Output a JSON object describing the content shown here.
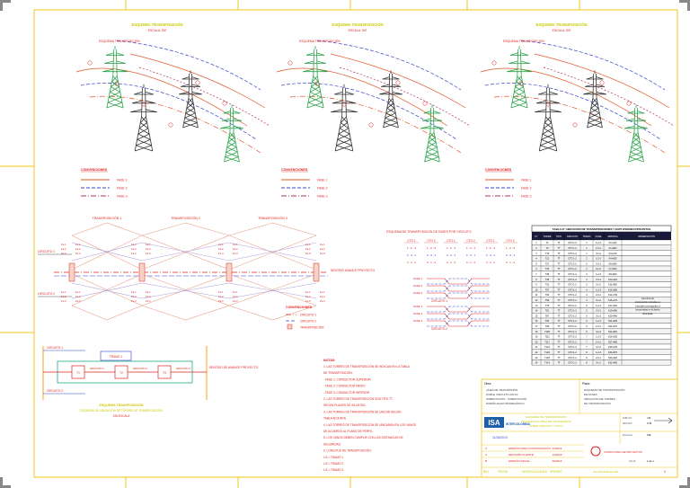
{
  "panels": [
    {
      "title": "ESQUEMA TRANSPOSICIÓN",
      "sub": "ESCALA: S/E",
      "legend": "CONVENCIONES",
      "phases": [
        "FASE 1",
        "FASE 2",
        "FASE 3"
      ]
    },
    {
      "title": "ESQUEMA TRANSPOSICIÓN",
      "sub": "ESCALA: S/E",
      "legend": "CONVENCIONES",
      "phases": [
        "FASE 1",
        "FASE 2",
        "FASE 3"
      ]
    },
    {
      "title": "ESQUEMA TRANSPOSICIÓN",
      "sub": "ESCALA: S/E",
      "legend": "CONVENCIONES",
      "phases": [
        "FASE 1",
        "FASE 2",
        "FASE 3"
      ]
    }
  ],
  "circuit_diagram": {
    "transp_labels": [
      "TRANSPOSICIÓN 1",
      "TRANSPOSICIÓN 2",
      "TRANSPOSICIÓN 3"
    ],
    "left_labels": [
      "CIRCUITO 1",
      "CIRCUITO 2"
    ],
    "right_label": "SENTIDO AVANCE PROYECTO",
    "legend_title": "CONVENCIONES",
    "legend_items": [
      "CIRCUITO 1",
      "CIRCUITO 2",
      "TRANSPOSICIÓN"
    ],
    "phase_letters": [
      "Fa 1",
      "Fa 2",
      "Fa 3"
    ]
  },
  "phase_table": {
    "title": "ESQUEMA DE TRANSPOSICIÓN DE FASES POR CIRCUITO",
    "headers": [
      "CTO 1",
      "CTO 2",
      "CTO 1",
      "CTO 2",
      "CTO 1",
      "CTO 2"
    ],
    "rows": [
      "1 - 2 - 3",
      "2 - 3 - 1",
      "3 - 1 - 2"
    ],
    "section_a": "CIRCUITO 1",
    "section_b": "CIRCUITO 2",
    "fase_labels": [
      "FASE 1",
      "FASE 2",
      "FASE 3"
    ]
  },
  "block_diagram": {
    "circuito_top": "CIRCUITO 1",
    "circuito_bottom": "CIRCUITO 2",
    "top_box": "TRAMO 1",
    "boxes": [
      "T1",
      "T2",
      "T3"
    ],
    "section_labels": [
      "SECCIÓN 1",
      "SECCIÓN 2",
      "SECCIÓN 3"
    ],
    "right_title": "SENTIDO DE AVANCE PROYECTO",
    "caption_title": "ESQUEMA TRANSPOSICIÓN",
    "caption_sub": "ESQUEMA DE UBICACIÓN DE TORRES DE TRANSPOSICIÓN",
    "caption_scale": "SIN ESCALA"
  },
  "notes": {
    "title": "NOTAS:",
    "lines": [
      "1. LAS TORRES DE TRANSPOSICIÓN SE INDICAN EN LA TABLA",
      "   DE TRANSPOSICIÓN.",
      "   - FASE 1: CONDUCTOR SUPERIOR",
      "   - FASE 2: CONDUCTOR MEDIO",
      "   - FASE 3: CONDUCTOR INFERIOR",
      "2. LAS TORRES DE TRANSPOSICIÓN SON TIPO TT.",
      "   SEGÚN PLANOS DE SILUETAS.",
      "3. LAS TORRES DE TRANSPOSICIÓN SE UBICAN SEGÚN",
      "   TABLA ADJUNTA.",
      "4. LAS TORRES DE TRANSPOSICIÓN SE UBICARÁN EN LOS VANOS",
      "   DE ACUERDO AL PLANO DE PERFIL.",
      "5. LOS VANOS DEBEN CUMPLIR CON LAS DISTANCIAS DE",
      "   SEGURIDAD.",
      "6. LONGITUD DE TRANSPOSICIÓN:",
      "      L/3 = TRAMO 1",
      "      L/3 = TRAMO 2",
      "      L/3 = TRAMO 3"
    ]
  },
  "table": {
    "title": "TABLA N° UBICACIÓN DE TRANSPOSICIONES Y EXPLOSIONES PREVISTAS",
    "headers": [
      "N°",
      "TORRE",
      "TIPO",
      "CIRCUITO",
      "TRAMO",
      "FASE",
      "ABSCISA",
      "OBSERVACIÓN"
    ],
    "rows": [
      [
        "1",
        "T4",
        "TT",
        "CTO 1-2",
        "1",
        "1-2-3",
        "K0+420",
        ""
      ],
      [
        "2",
        "T9",
        "TT",
        "CTO 1-2",
        "1",
        "2-3-1",
        "K1+860",
        ""
      ],
      [
        "3",
        "T15",
        "TT",
        "CTO 1-2",
        "1",
        "3-1-2",
        "K3+210",
        ""
      ],
      [
        "4",
        "T21",
        "TT",
        "CTO 1-2",
        "2",
        "1-2-3",
        "K4+650",
        ""
      ],
      [
        "5",
        "T27",
        "TT",
        "CTO 1-2",
        "2",
        "2-3-1",
        "K6+080",
        ""
      ],
      [
        "6",
        "T33",
        "TT",
        "CTO 1-2",
        "2",
        "3-1-2",
        "K7+520",
        ""
      ],
      [
        "7",
        "T39",
        "TT",
        "CTO 1-2",
        "3",
        "1-2-3",
        "K8+960",
        ""
      ],
      [
        "8",
        "T45",
        "TT",
        "CTO 1-2",
        "3",
        "2-3-1",
        "K10+410",
        ""
      ],
      [
        "9",
        "T51",
        "TT",
        "CTO 1-2",
        "3",
        "3-1-2",
        "K11+850",
        ""
      ],
      [
        "10",
        "T57",
        "TT",
        "CTO 1-2",
        "4",
        "1-2-3",
        "K13+290",
        ""
      ],
      [
        "11",
        "T63",
        "TT",
        "CTO 1-2",
        "4",
        "2-3-1",
        "K14+730",
        ""
      ],
      [
        "12",
        "T69",
        "TT",
        "CTO 1-2",
        "4",
        "3-1-2",
        "K16+170",
        ""
      ],
      [
        "13",
        "T75",
        "TT",
        "CTO 1-2",
        "5",
        "1-2-3",
        "K17+610",
        ""
      ],
      [
        "14",
        "T81",
        "TT",
        "CTO 1-2",
        "5",
        "2-3-1",
        "K19+050",
        ""
      ],
      [
        "15",
        "T87",
        "TT",
        "CTO 1-2",
        "5",
        "3-1-2",
        "K20+490",
        ""
      ],
      [
        "16",
        "T93",
        "TT",
        "CTO 1-2",
        "6",
        "1-2-3",
        "K21+930",
        ""
      ],
      [
        "17",
        "T99",
        "TT",
        "CTO 1-2",
        "6",
        "2-3-1",
        "K23+370",
        ""
      ],
      [
        "18",
        "T105",
        "TT",
        "CTO 1-2",
        "6",
        "3-1-2",
        "K24+810",
        ""
      ],
      [
        "19",
        "T111",
        "TT",
        "CTO 1-2",
        "7",
        "1-2-3",
        "K26+250",
        ""
      ],
      [
        "20",
        "T117",
        "TT",
        "CTO 1-2",
        "7",
        "2-3-1",
        "K27+690",
        ""
      ],
      [
        "21",
        "T123",
        "TT",
        "CTO 1-2",
        "7",
        "3-1-2",
        "K29+130",
        ""
      ],
      [
        "22",
        "T129",
        "TT",
        "CTO 1-2",
        "8",
        "1-2-3",
        "K30+570",
        ""
      ],
      [
        "23",
        "T135",
        "TT",
        "CTO 1-2",
        "8",
        "2-3-1",
        "K32+010",
        ""
      ],
      [
        "24",
        "T141",
        "TT",
        "CTO 1-2",
        "8",
        "3-1-2",
        "K33+450",
        ""
      ]
    ],
    "side_note": "Las torres de transposición indicadas en esta tabla corresponden a las previstas en el diseño de la línea."
  },
  "titleblock": {
    "left_title": "Obra:",
    "left_lines": [
      "LÍNEA DE TRANSMISIÓN",
      "DOBLE CIRCUITO 230 kV",
      "SUBESTACIÓN - SUBESTACIÓN",
      "DISEÑO ELECTROMECÁNICO"
    ],
    "right_title": "Plano:",
    "right_lines": [
      "ESQUEMA DE TRANSPOSICIÓN",
      "DE FASES",
      "UBICACIÓN DE TORRES",
      "DE TRANSPOSICIÓN"
    ],
    "logo": "ISA",
    "logo_sub": "INTERCOLOMBIA",
    "desc_lines": [
      "ESQUEMA DE TRANSPOSICIÓN",
      "DE FASES EN LÍNEA DE TRANSMISIÓN",
      "DOBLE CIRCUITO - 230 kV"
    ],
    "drawn_label": "DIBUJÓ",
    "drawn_val": "J.R.",
    "checked_label": "REVISÓ",
    "checked_val": "C.M.",
    "scale_label": "ESCALA",
    "scale_val": "S/E",
    "date_val": "11/26/2019",
    "company": "CONSULTORÍA DE PROYECTOS",
    "revisions": [
      [
        "0",
        "EMISIÓN PARA CONSTRUCCIÓN",
        "11/2019"
      ],
      [
        "A",
        "REVISIÓN CLIENTE",
        "10/2019"
      ],
      [
        "B",
        "EMISIÓN INICIAL",
        "09/2019"
      ]
    ],
    "rev_label": "REV",
    "date_label": "FECHA",
    "mod_label": "MODIFICACIONES",
    "approved_label": "APROBÓ",
    "sheet_label": "HOJA",
    "sheet_val": "1 de 1",
    "drawing_no": "ISA-TRANSP-EL-001",
    "rev_no": "0"
  }
}
